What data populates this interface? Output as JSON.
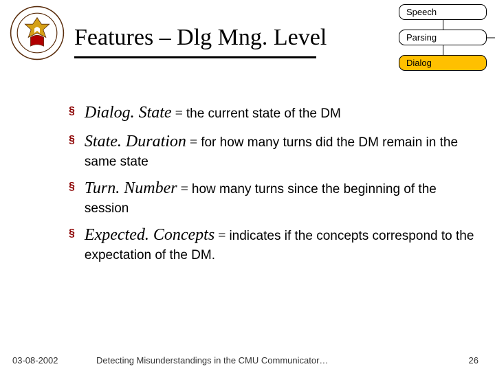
{
  "header": {
    "title": "Features – Dlg Mng. Level",
    "stack": {
      "speech": "Speech",
      "parsing": "Parsing",
      "dialog": "Dialog"
    }
  },
  "bullets": [
    {
      "term": "Dialog. State",
      "eq": " = ",
      "desc": "the current state of the DM"
    },
    {
      "term": "State. Duration",
      "eq": " = ",
      "desc": "for how many turns did the DM remain in the same state"
    },
    {
      "term": "Turn. Number",
      "eq": " = ",
      "desc": "how many turns since the beginning of the session"
    },
    {
      "term": "Expected. Concepts",
      "eq": " = ",
      "desc": "indicates if the concepts correspond to the expectation of the DM."
    }
  ],
  "footer": {
    "date": "03-08-2002",
    "subtitle": "Detecting Misunderstandings in the CMU Communicator…",
    "page": "26"
  }
}
